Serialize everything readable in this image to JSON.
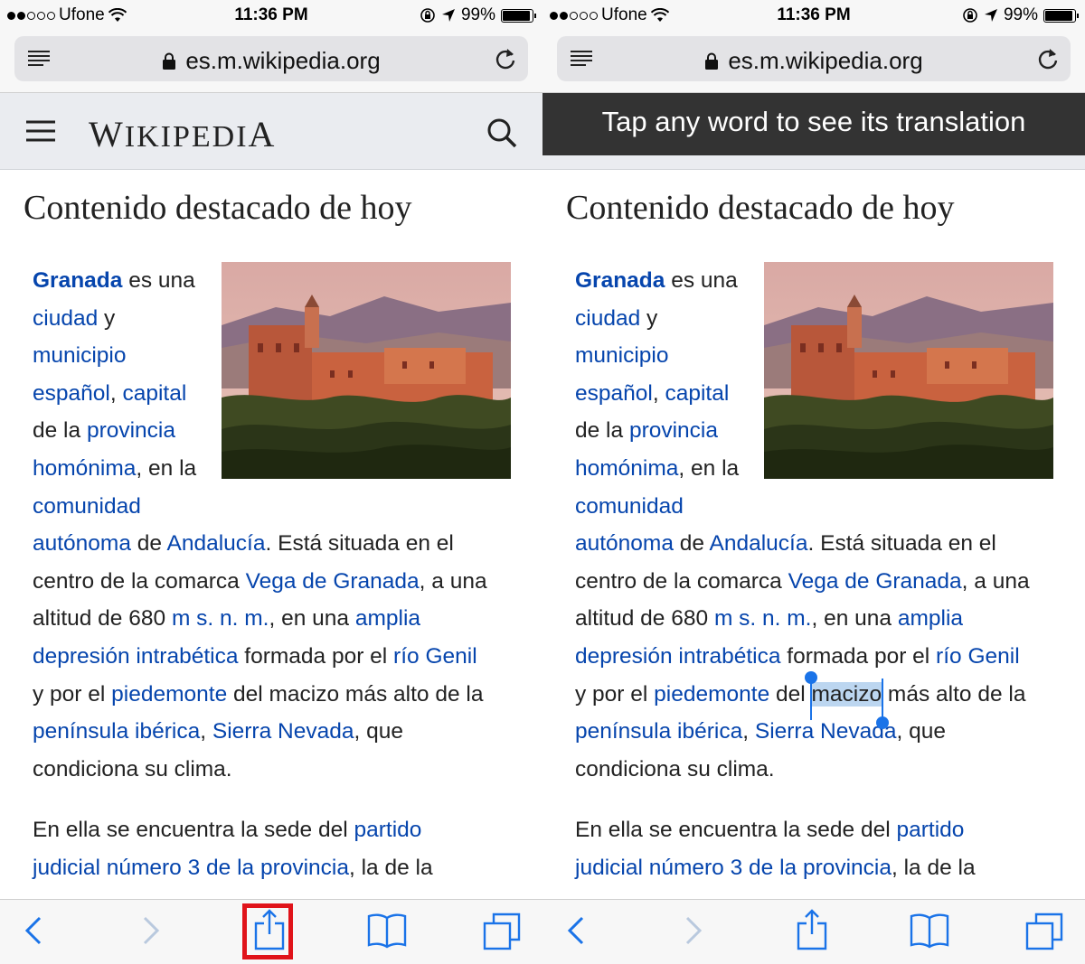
{
  "status_bar": {
    "carrier": "Ufone",
    "time": "11:36 PM",
    "battery": "99%",
    "signal_bars_filled": 2,
    "signal_bars_total": 5
  },
  "address_bar": {
    "url": "es.m.wikipedia.org"
  },
  "wiki_header": {
    "wordmark_first": "W",
    "wordmark_rest": "IKIPEDI",
    "wordmark_last": "A"
  },
  "translation_banner": {
    "text": "Tap any word to see its translation"
  },
  "article": {
    "title": "Contenido destacado de hoy",
    "p1": {
      "l1a": "Granada",
      "l1b": " es una",
      "l2a": "ciudad",
      "l2b": " y",
      "l3a": "municipio",
      "l4a": "español",
      "l4b": ", ",
      "l4c": "capital",
      "l5a": "de la ",
      "l5b": "provincia",
      "l6a": "homónima",
      "l6b": ", en la",
      "l7a": "comunidad",
      "l8a": "autónoma",
      "l8b": " de ",
      "l8c": "Andalucía",
      "l8d": ". Está situada en el",
      "l9a": "centro de la comarca ",
      "l9b": "Vega de Granada",
      "l9c": ", a una",
      "l10a": "altitud de 680 ",
      "l10b": "m s. n. m.",
      "l10c": ", en una ",
      "l10d": "amplia",
      "l11a": "depresión intrabética",
      "l11b": " formada por el ",
      "l11c": "río Genil",
      "l12a": "y por el ",
      "l12b": "piedemonte",
      "l12c": " del ",
      "l12d": "macizo",
      "l12e": " más alto de la",
      "l13a": "península ibérica",
      "l13b": ", ",
      "l13c": "Sierra Nevada",
      "l13d": ", que",
      "l14a": "condiciona su clima."
    },
    "p2": {
      "l1a": "En ella se encuentra la sede del ",
      "l1b": "partido",
      "l2a": "judicial número 3 de la provincia",
      "l2b": ", la de la"
    }
  },
  "colors": {
    "link": "#0645ad",
    "text": "#222222",
    "banner_bg": "#333333",
    "selection": "#bcd6f0",
    "handle": "#1a73e8",
    "highlight_box": "#e0131a",
    "toolbar_icon": "#1a73e8"
  },
  "toolbar": {
    "icons": [
      "back-icon",
      "forward-icon",
      "share-icon",
      "bookmarks-icon",
      "tabs-icon"
    ]
  }
}
